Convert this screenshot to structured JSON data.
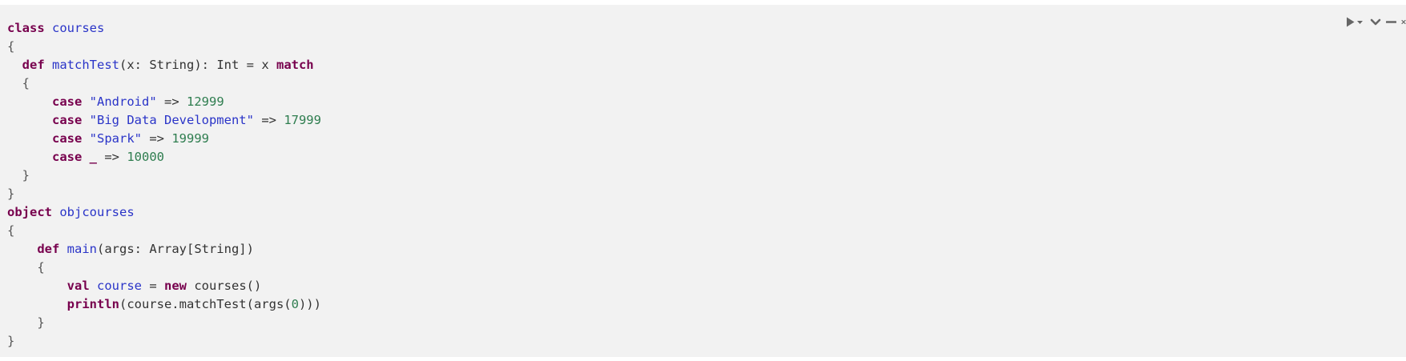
{
  "code_block": {
    "language": "scala",
    "lines": [
      [
        {
          "t": "class",
          "c": "keyword"
        },
        {
          "t": " ",
          "c": "plain"
        },
        {
          "t": "courses",
          "c": "def"
        }
      ],
      [
        {
          "t": "{",
          "c": "punct"
        }
      ],
      [
        {
          "t": "  ",
          "c": "plain"
        },
        {
          "t": "def",
          "c": "keyword"
        },
        {
          "t": " ",
          "c": "plain"
        },
        {
          "t": "matchTest",
          "c": "def"
        },
        {
          "t": "(x: String): Int = x ",
          "c": "plain"
        },
        {
          "t": "match",
          "c": "keyword"
        }
      ],
      [
        {
          "t": "  {",
          "c": "punct"
        }
      ],
      [
        {
          "t": "      ",
          "c": "plain"
        },
        {
          "t": "case",
          "c": "keyword"
        },
        {
          "t": " ",
          "c": "plain"
        },
        {
          "t": "\"Android\"",
          "c": "string"
        },
        {
          "t": " => ",
          "c": "plain"
        },
        {
          "t": "12999",
          "c": "number"
        }
      ],
      [
        {
          "t": "      ",
          "c": "plain"
        },
        {
          "t": "case",
          "c": "keyword"
        },
        {
          "t": " ",
          "c": "plain"
        },
        {
          "t": "\"Big Data Development\"",
          "c": "string"
        },
        {
          "t": " => ",
          "c": "plain"
        },
        {
          "t": "17999",
          "c": "number"
        }
      ],
      [
        {
          "t": "      ",
          "c": "plain"
        },
        {
          "t": "case",
          "c": "keyword"
        },
        {
          "t": " ",
          "c": "plain"
        },
        {
          "t": "\"Spark\"",
          "c": "string"
        },
        {
          "t": " => ",
          "c": "plain"
        },
        {
          "t": "19999",
          "c": "number"
        }
      ],
      [
        {
          "t": "      ",
          "c": "plain"
        },
        {
          "t": "case",
          "c": "keyword"
        },
        {
          "t": " ",
          "c": "plain"
        },
        {
          "t": "_",
          "c": "keyword"
        },
        {
          "t": " => ",
          "c": "plain"
        },
        {
          "t": "10000",
          "c": "number"
        }
      ],
      [
        {
          "t": "  }",
          "c": "punct"
        }
      ],
      [
        {
          "t": "}",
          "c": "punct"
        }
      ],
      [
        {
          "t": "object",
          "c": "keyword"
        },
        {
          "t": " ",
          "c": "plain"
        },
        {
          "t": "objcourses",
          "c": "def"
        }
      ],
      [
        {
          "t": "{",
          "c": "punct"
        }
      ],
      [
        {
          "t": "    ",
          "c": "plain"
        },
        {
          "t": "def",
          "c": "keyword"
        },
        {
          "t": " ",
          "c": "plain"
        },
        {
          "t": "main",
          "c": "def"
        },
        {
          "t": "(args: Array[String])",
          "c": "plain"
        }
      ],
      [
        {
          "t": "    {",
          "c": "punct"
        }
      ],
      [
        {
          "t": "        ",
          "c": "plain"
        },
        {
          "t": "val",
          "c": "keyword"
        },
        {
          "t": " ",
          "c": "plain"
        },
        {
          "t": "course",
          "c": "def"
        },
        {
          "t": " = ",
          "c": "plain"
        },
        {
          "t": "new",
          "c": "keyword"
        },
        {
          "t": " courses()",
          "c": "plain"
        }
      ],
      [
        {
          "t": "        ",
          "c": "plain"
        },
        {
          "t": "println",
          "c": "keyword"
        },
        {
          "t": "(course.matchTest(args(",
          "c": "plain"
        },
        {
          "t": "0",
          "c": "number"
        },
        {
          "t": ")))",
          "c": "plain"
        }
      ],
      [
        {
          "t": "    }",
          "c": "punct"
        }
      ],
      [
        {
          "t": "}",
          "c": "punct"
        }
      ]
    ]
  },
  "toolbar": {
    "buttons": [
      {
        "name": "run-icon-button",
        "icon": "play-icon"
      },
      {
        "name": "run-options-button",
        "icon": "caret-down-icon"
      },
      {
        "name": "expand-button",
        "icon": "chevron-down-icon"
      },
      {
        "name": "minimize-button",
        "icon": "minus-icon"
      },
      {
        "name": "close-button",
        "icon": "close-icon"
      }
    ]
  },
  "colors": {
    "background": "#f2f2f2",
    "keyword": "#77004d",
    "identifier": "#2a34c8",
    "number": "#2e7d4f",
    "text": "#333333",
    "icon": "#666666"
  }
}
